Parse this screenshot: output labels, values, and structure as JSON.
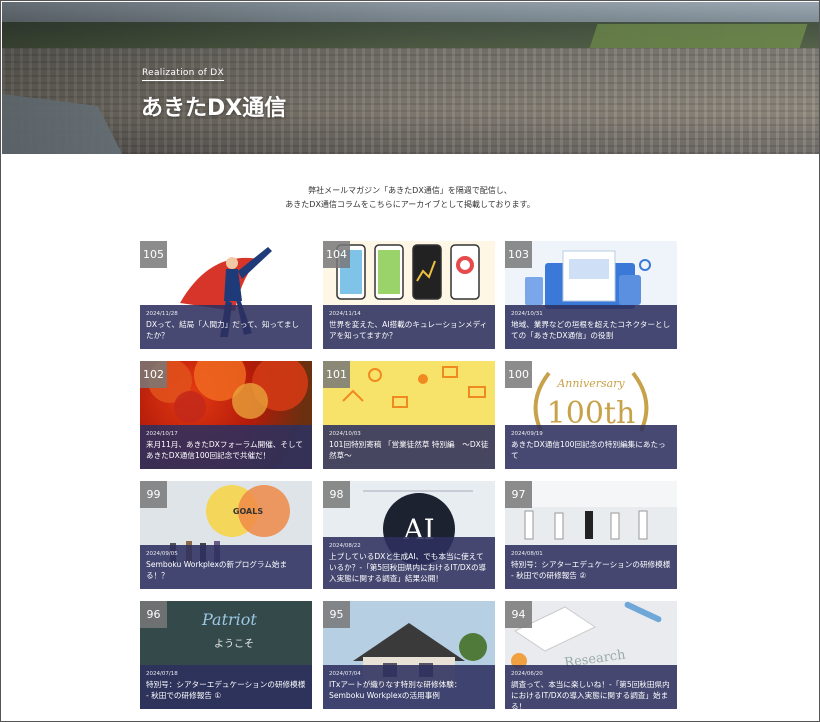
{
  "hero": {
    "subtitle": "Realization of DX",
    "title": "あきたDX通信"
  },
  "intro": {
    "line1": "弊社メールマガジン「あきたDX通信」を隔週で配信し、",
    "line2": "あきたDX通信コラムをこちらにアーカイブとして掲載しております。"
  },
  "goals_label": "GOALS",
  "ai_label": "AI",
  "anniversary": {
    "script": "Anniversary",
    "big": "100th"
  },
  "research_label": "Research",
  "patriot_label": "Patriot",
  "youkoso_label": "ようこそ",
  "articles": [
    {
      "num": "105",
      "date": "2024/11/28",
      "title": "DXって、結局「人間力」だって、知ってましたか？"
    },
    {
      "num": "104",
      "date": "2024/11/14",
      "title": "世界を変えた、AI搭載のキュレーションメディアを知ってますか？"
    },
    {
      "num": "103",
      "date": "2024/10/31",
      "title": "地域、業界などの垣根を超えたコネクターとしての「あきたDX通信」の役割"
    },
    {
      "num": "102",
      "date": "2024/10/17",
      "title": "来月11月、あきたDXフォーラム開催、そしてあきたDX通信100回記念で共催だ！"
    },
    {
      "num": "101",
      "date": "2024/10/03",
      "title": "101回特別寄稿 「営業徒然草 特別編　〜DX徒然草〜"
    },
    {
      "num": "100",
      "date": "2024/09/19",
      "title": "あきたDX通信100回記念の特別編集にあたって"
    },
    {
      "num": "99",
      "date": "2024/09/05",
      "title": "Semboku Workplexの新プログラム始まる！？"
    },
    {
      "num": "98",
      "date": "2024/08/22",
      "title": "上プしているDXと生成AI、でも本当に使えているか？-「第5回秋田県内におけるIT/DXの導入実態に関する調査」結果公開！"
    },
    {
      "num": "97",
      "date": "2024/08/01",
      "title": "特別号：シアターエデュケーションの研修模様 - 秋田での研修報告 ②"
    },
    {
      "num": "96",
      "date": "2024/07/18",
      "title": "特別号：シアターエデュケーションの研修模様 - 秋田での研修報告 ①"
    },
    {
      "num": "95",
      "date": "2024/07/04",
      "title": "ITxアートが織りなす特別な研修体験：Semboku Workplexの活用事例"
    },
    {
      "num": "94",
      "date": "2024/06/20",
      "title": "調査って、本当に楽しいね！-「第5回秋田県内におけるIT/DXの導入実態に関する調査」始まる！"
    }
  ]
}
